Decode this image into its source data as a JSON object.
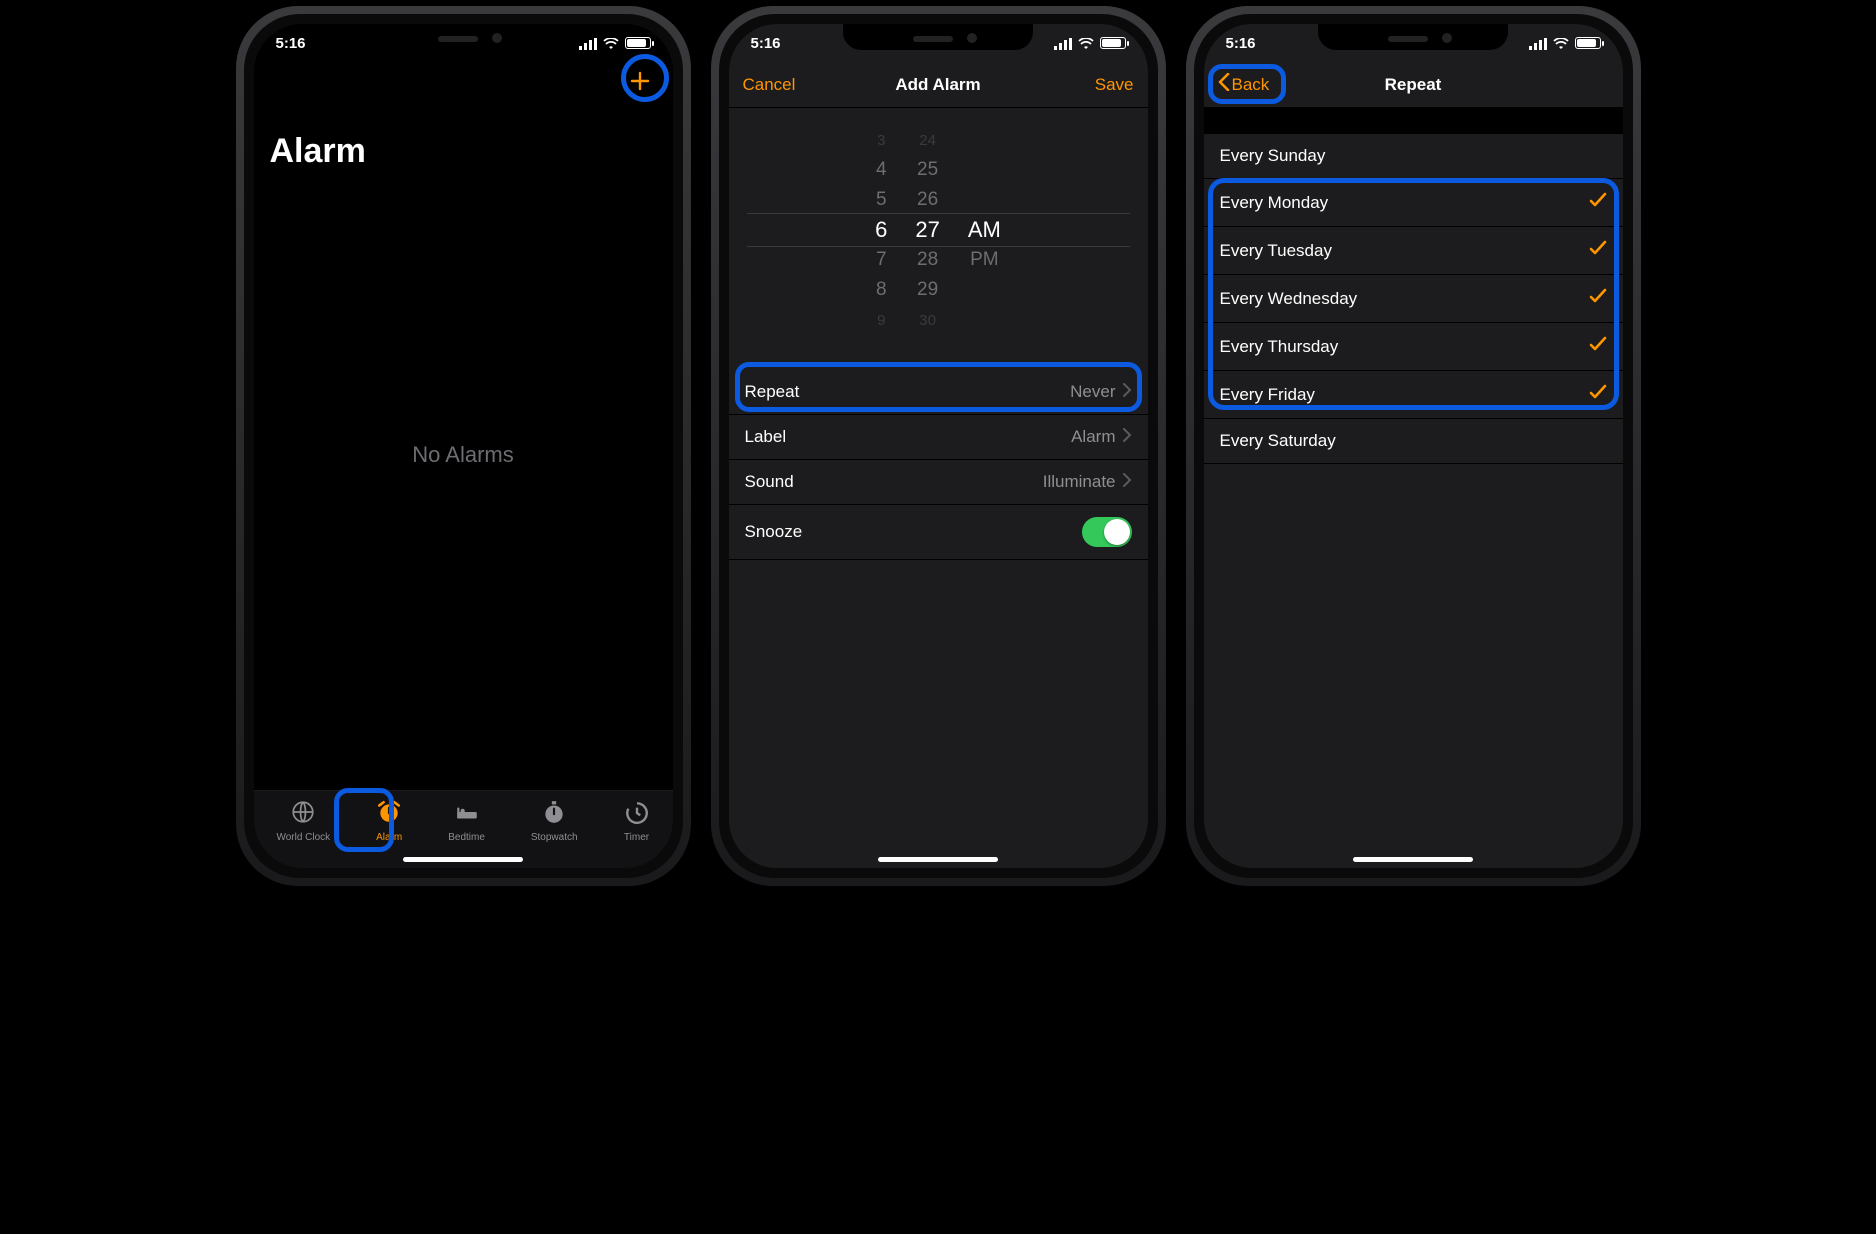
{
  "colors": {
    "accent": "#ff9500",
    "highlight_blue": "#0b5ae0",
    "switch_green": "#34c759"
  },
  "status": {
    "time": "5:16"
  },
  "screen1": {
    "title": "Alarm",
    "empty_text": "No Alarms",
    "tabs": [
      {
        "label": "World Clock",
        "icon": "globe-icon"
      },
      {
        "label": "Alarm",
        "icon": "alarm-icon"
      },
      {
        "label": "Bedtime",
        "icon": "bed-icon"
      },
      {
        "label": "Stopwatch",
        "icon": "stopwatch-icon"
      },
      {
        "label": "Timer",
        "icon": "timer-icon"
      }
    ],
    "active_tab": "Alarm"
  },
  "screen2": {
    "nav": {
      "left": "Cancel",
      "title": "Add Alarm",
      "right": "Save"
    },
    "picker": {
      "hours": [
        "3",
        "4",
        "5",
        "6",
        "7",
        "8",
        "9"
      ],
      "minutes": [
        "24",
        "25",
        "26",
        "27",
        "28",
        "29",
        "30"
      ],
      "periods": [
        "AM",
        "PM"
      ],
      "selected_hour": "6",
      "selected_minute": "27",
      "selected_period": "AM"
    },
    "rows": {
      "repeat": {
        "label": "Repeat",
        "value": "Never"
      },
      "label": {
        "label": "Label",
        "value": "Alarm"
      },
      "sound": {
        "label": "Sound",
        "value": "Illuminate"
      },
      "snooze": {
        "label": "Snooze",
        "on": true
      }
    }
  },
  "screen3": {
    "nav": {
      "back": "Back",
      "title": "Repeat"
    },
    "days": [
      {
        "label": "Every Sunday",
        "checked": false
      },
      {
        "label": "Every Monday",
        "checked": true
      },
      {
        "label": "Every Tuesday",
        "checked": true
      },
      {
        "label": "Every Wednesday",
        "checked": true
      },
      {
        "label": "Every Thursday",
        "checked": true
      },
      {
        "label": "Every Friday",
        "checked": true
      },
      {
        "label": "Every Saturday",
        "checked": false
      }
    ]
  }
}
